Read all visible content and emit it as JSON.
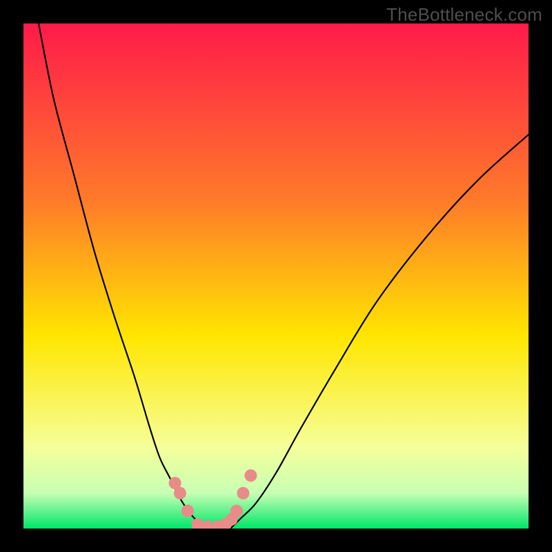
{
  "watermark": "TheBottleneck.com",
  "colors": {
    "frame_bg": "#000000",
    "gradient_top": "#ff1a4a",
    "gradient_mid1": "#ff6f2a",
    "gradient_mid2": "#ffe600",
    "gradient_low": "#f7ffb0",
    "gradient_bottom": "#00e668",
    "curve_stroke": "#000000",
    "marker_fill": "#e98b88"
  },
  "chart_data": {
    "type": "line",
    "title": "",
    "xlabel": "",
    "ylabel": "",
    "xlim": [
      0,
      100
    ],
    "ylim": [
      0,
      100
    ],
    "note": "axes unlabeled; values are estimated percentages of plot area",
    "series": [
      {
        "name": "left-curve",
        "x": [
          3,
          6,
          10,
          14,
          18,
          22,
          25,
          27,
          29,
          31,
          33,
          35,
          37
        ],
        "y": [
          100,
          85,
          70,
          55,
          42,
          30,
          20,
          14,
          10,
          6,
          3,
          1,
          0
        ]
      },
      {
        "name": "right-curve",
        "x": [
          41,
          43,
          46,
          50,
          55,
          62,
          70,
          80,
          90,
          100
        ],
        "y": [
          0,
          2,
          5,
          11,
          20,
          32,
          45,
          58,
          69,
          78
        ]
      },
      {
        "name": "bottom-plateau",
        "x": [
          35,
          37,
          39,
          41
        ],
        "y": [
          0,
          0,
          0,
          0
        ]
      }
    ],
    "markers": [
      {
        "x": 30.0,
        "y": 9.0
      },
      {
        "x": 31.0,
        "y": 7.0
      },
      {
        "x": 32.5,
        "y": 3.5
      },
      {
        "x": 34.5,
        "y": 0.8
      },
      {
        "x": 36.5,
        "y": 0.4
      },
      {
        "x": 38.5,
        "y": 0.4
      },
      {
        "x": 40.0,
        "y": 0.8
      },
      {
        "x": 41.2,
        "y": 1.8
      },
      {
        "x": 42.2,
        "y": 3.5
      },
      {
        "x": 43.5,
        "y": 7.0
      },
      {
        "x": 45.0,
        "y": 10.5
      }
    ],
    "gradient_bands_pct_from_top": [
      {
        "at": 0,
        "color": "#ff1a4a"
      },
      {
        "at": 35,
        "color": "#ff7a2a"
      },
      {
        "at": 62,
        "color": "#ffe600"
      },
      {
        "at": 84,
        "color": "#f5ff9a"
      },
      {
        "at": 93,
        "color": "#c7ffb4"
      },
      {
        "at": 100,
        "color": "#00e668"
      }
    ]
  }
}
